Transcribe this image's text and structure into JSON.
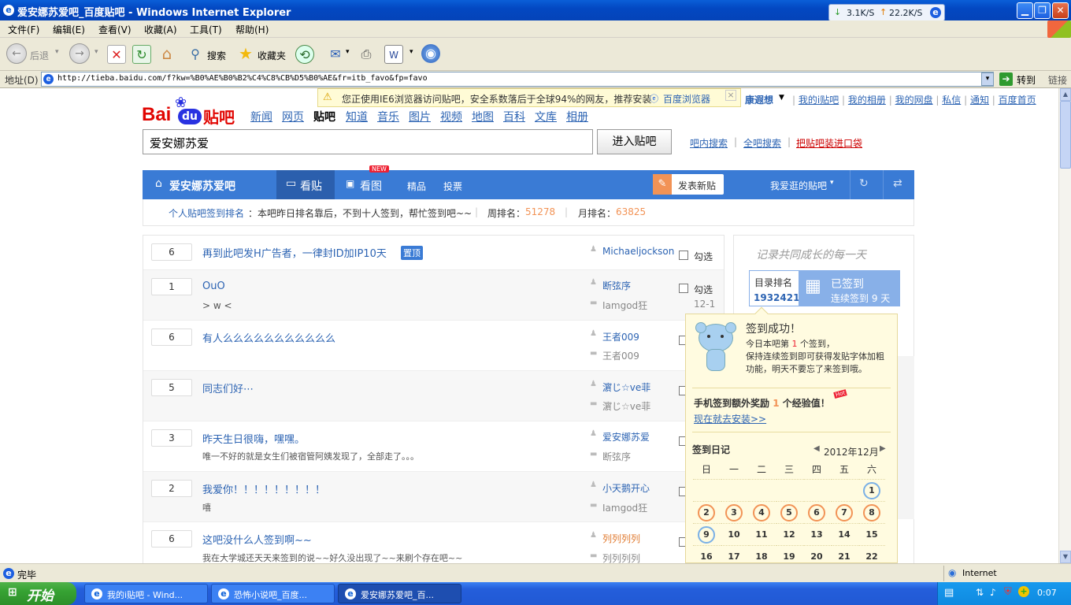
{
  "window": {
    "title": "爱安娜苏爱吧_百度贴吧 - Windows Internet Explorer",
    "net_down": "3.1K/S",
    "net_up": "22.2K/S"
  },
  "menu": [
    "文件(F)",
    "编辑(E)",
    "查看(V)",
    "收藏(A)",
    "工具(T)",
    "帮助(H)"
  ],
  "toolbar": {
    "back": "后退",
    "search": "搜索",
    "favorites": "收藏夹"
  },
  "address": {
    "label": "地址(D)",
    "url": "http://tieba.baidu.com/f?kw=%B0%AE%B0%B2%C4%C8%CB%D5%B0%AE&fr=itb_favo&fp=favo",
    "go": "转到",
    "links": "链接"
  },
  "warning": {
    "text": "您正使用IE6浏览器访问贴吧，安全系数落后于全球94%的网友，推荐安装",
    "link": "百度浏览器",
    "close": "×"
  },
  "userbar": {
    "user": "康遐想",
    "links": [
      "我的i贴吧",
      "我的相册",
      "我的网盘",
      "私信",
      "通知",
      "百度首页"
    ]
  },
  "logo": {
    "bai": "Bai",
    "du": "du",
    "tieba": "贴吧"
  },
  "nav": [
    "新闻",
    "网页",
    "贴吧",
    "知道",
    "音乐",
    "图片",
    "视频",
    "地图",
    "百科",
    "文库",
    "相册"
  ],
  "search": {
    "value": "爱安娜苏爱",
    "button": "进入贴吧",
    "links": [
      "吧内搜索",
      "全吧搜索",
      "把贴吧装进口袋"
    ]
  },
  "forumbar": {
    "name": "爱安娜苏爱吧",
    "tab_posts": "看贴",
    "tab_pics": "看图",
    "new_badge": "NEW",
    "tab_good": "精品",
    "tab_vote": "投票",
    "post_btn": "发表新贴",
    "my_forums": "我爱逛的贴吧"
  },
  "rankbar": {
    "label": "个人贴吧签到排名",
    "msg": "：本吧昨日排名靠后，不到十人签到，帮忙签到吧~~",
    "week_label": "周排名：",
    "week": "51278",
    "month_label": "月排名：",
    "month": "63825"
  },
  "threads": [
    {
      "replies": "6",
      "title": "再到此吧发H广告者，一律封ID加IP10天",
      "tag": "置顶",
      "abstract": "",
      "author": "Michaeljockson",
      "last": "",
      "date": ""
    },
    {
      "replies": "1",
      "title": "OuO",
      "tag": "",
      "abstract": "> w <",
      "author": "断弦序",
      "last": "Iamgod狂",
      "date": "12-1"
    },
    {
      "replies": "6",
      "title": "有人么么么么么么么么么么么",
      "tag": "",
      "abstract": "",
      "author": "王者009",
      "last": "王者009",
      "date": ""
    },
    {
      "replies": "5",
      "title": "同志们好⋯",
      "tag": "",
      "abstract": "",
      "author": "濵じ☆ve菲",
      "last": "濵じ☆ve菲",
      "date": ""
    },
    {
      "replies": "3",
      "title": "昨天生日很嗨，嘿嘿。",
      "tag": "",
      "abstract": "唯一不好的就是女生们被宿管阿姨发现了，全部走了。。。",
      "author": "爱安娜苏爱",
      "last": "断弦序",
      "date": ""
    },
    {
      "replies": "2",
      "title": "我爱你！！！！！！！！！",
      "tag": "",
      "abstract": "嘻",
      "author": "小天鹅开心",
      "last": "Iamgod狂",
      "date": ""
    },
    {
      "replies": "6",
      "title": "这吧没什么人签到啊~~",
      "tag": "",
      "abstract": "我在大学城还天天来签到的说~~好久没出现了~~来刷个存在吧~~",
      "author": "列列列列",
      "last": "列列列列",
      "date": ""
    }
  ],
  "check_label": "勾选",
  "signin": {
    "slogan": "记录共同成长的每一天",
    "rank_label": "目录排名",
    "rank": "1932421",
    "status": "已签到",
    "streak": "连续签到 9 天"
  },
  "popup": {
    "title": "签到成功！",
    "line1_a": "今日本吧第",
    "line1_n": "1",
    "line1_b": "个签到，",
    "line2": "保持连续签到即可获得发贴字体加粗功能，明天不要忘了来签到哦。",
    "mobile_a": "手机签到额外奖励",
    "mobile_n": "1",
    "mobile_b": "个经验值！",
    "hot": "Hot",
    "install": "现在就去安装>>",
    "diary": "签到日记",
    "month": "2012年12月",
    "weekdays": [
      "日",
      "一",
      "二",
      "三",
      "四",
      "五",
      "六"
    ],
    "days": [
      "",
      "",
      "",
      "",
      "",
      "",
      "1",
      "2",
      "3",
      "4",
      "5",
      "6",
      "7",
      "8",
      "9",
      "10",
      "11",
      "12",
      "13",
      "14",
      "15",
      "16",
      "17",
      "18",
      "19",
      "20",
      "21",
      "22"
    ],
    "signed_days": [
      "1",
      "2",
      "3",
      "4",
      "5",
      "6",
      "7",
      "8",
      "9"
    ]
  },
  "status": {
    "text": "完毕",
    "zone": "Internet"
  },
  "taskbar": {
    "start": "开始",
    "tasks": [
      "我的i贴吧 - Wind...",
      "恐怖小说吧_百度...",
      "爱安娜苏爱吧_百..."
    ],
    "clock": "0:07"
  },
  "colors": {
    "accent": "#3a7bd5",
    "orange": "#f29356",
    "link": "#2d64b3"
  }
}
